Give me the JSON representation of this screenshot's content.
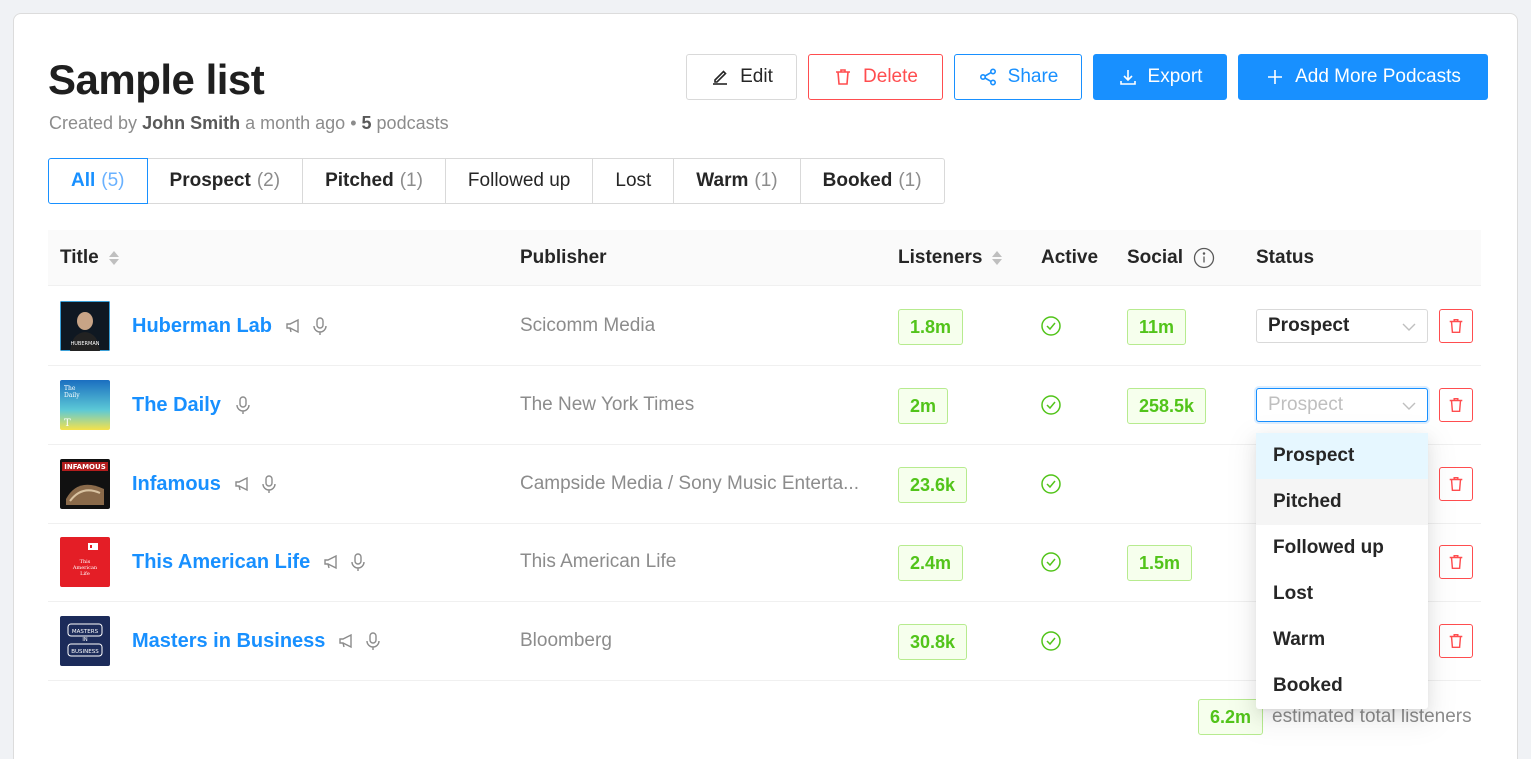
{
  "list": {
    "title": "Sample list",
    "meta_prefix": "Created by",
    "author": "John Smith",
    "time_ago": "a month ago",
    "bullet": "•",
    "podcast_count": "5",
    "podcast_word": "podcasts"
  },
  "toolbar": {
    "edit_label": "Edit",
    "delete_label": "Delete",
    "share_label": "Share",
    "export_label": "Export",
    "add_label": "Add More Podcasts"
  },
  "tabs": [
    {
      "label": "All",
      "count": "(5)",
      "active": true
    },
    {
      "label": "Prospect",
      "count": "(2)"
    },
    {
      "label": "Pitched",
      "count": "(1)"
    },
    {
      "label": "Followed up",
      "count": ""
    },
    {
      "label": "Lost",
      "count": ""
    },
    {
      "label": "Warm",
      "count": "(1)"
    },
    {
      "label": "Booked",
      "count": "(1)"
    }
  ],
  "table": {
    "headers": {
      "title": "Title",
      "publisher": "Publisher",
      "listeners": "Listeners",
      "active": "Active",
      "social": "Social",
      "status": "Status"
    },
    "rows": [
      {
        "title": "Huberman Lab",
        "publisher": "Scicomm Media",
        "listeners": "1.8m",
        "social": "11m",
        "status": "Prospect",
        "icons": [
          "megaphone-icon",
          "microphone-icon"
        ]
      },
      {
        "title": "The Daily",
        "publisher": "The New York Times",
        "listeners": "2m",
        "social": "258.5k",
        "status": "Prospect",
        "icons": [
          "microphone-icon"
        ]
      },
      {
        "title": "Infamous",
        "publisher": "Campside Media / Sony Music Enterta...",
        "listeners": "23.6k",
        "social": "",
        "status": "",
        "icons": [
          "megaphone-icon",
          "microphone-icon"
        ]
      },
      {
        "title": "This American Life",
        "publisher": "This American Life",
        "listeners": "2.4m",
        "social": "1.5m",
        "status": "",
        "icons": [
          "megaphone-icon",
          "microphone-icon"
        ]
      },
      {
        "title": "Masters in Business",
        "publisher": "Bloomberg",
        "listeners": "30.8k",
        "social": "",
        "status": "",
        "icons": [
          "megaphone-icon",
          "microphone-icon"
        ]
      }
    ]
  },
  "status_dropdown": {
    "options": [
      "Prospect",
      "Pitched",
      "Followed up",
      "Lost",
      "Warm",
      "Booked"
    ],
    "selected": "Prospect",
    "hovered": "Pitched"
  },
  "footer": {
    "total": "6.2m",
    "total_label": "estimated total listeners"
  },
  "colors": {
    "primary": "#1890ff",
    "danger": "#ff4d4f",
    "success": "#52c41a"
  }
}
